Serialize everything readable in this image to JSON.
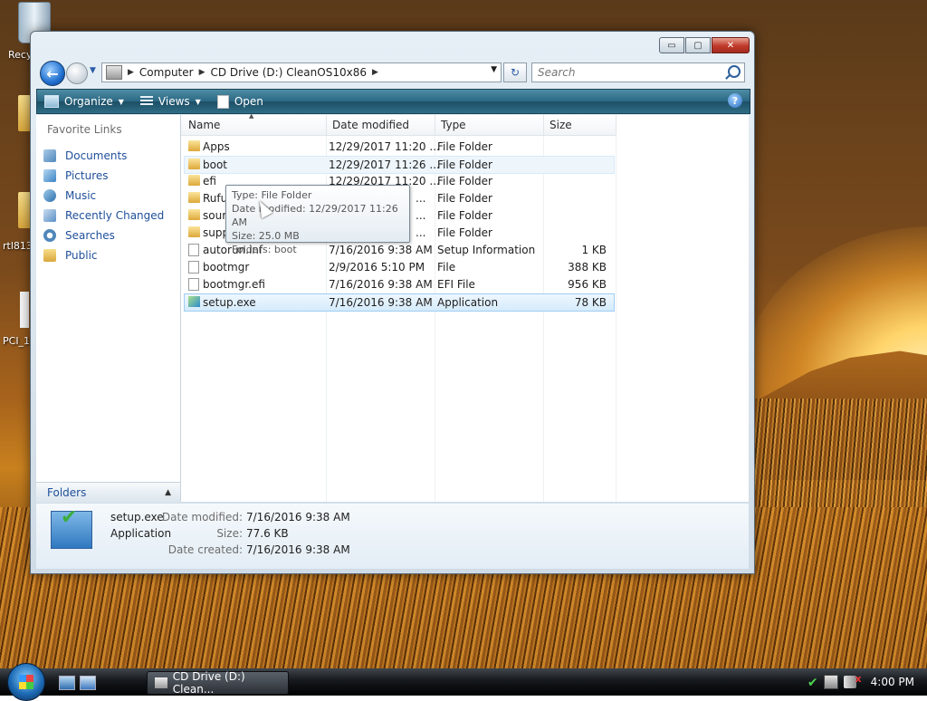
{
  "desktop": {
    "icons": [
      {
        "label": "Recy"
      },
      {
        "label": "rtl813"
      },
      {
        "label": "PCI_1("
      }
    ]
  },
  "window": {
    "buttons": {
      "minimize": "▭",
      "maximize": "▢",
      "close": "✕"
    },
    "address": {
      "crumbs": [
        "Computer",
        "CD Drive (D:) CleanOS10x86"
      ]
    },
    "search": {
      "placeholder": "Search"
    },
    "toolbar": {
      "organize": "Organize",
      "views": "Views",
      "open": "Open",
      "help": "?"
    },
    "nav": {
      "header": "Favorite Links",
      "items": [
        "Documents",
        "Pictures",
        "Music",
        "Recently Changed",
        "Searches",
        "Public"
      ],
      "folders_label": "Folders"
    },
    "columns": {
      "name": "Name",
      "date": "Date modified",
      "type": "Type",
      "size": "Size"
    },
    "files": [
      {
        "name": "Apps",
        "date": "12/29/2017 11:20 ...",
        "type": "File Folder",
        "size": "",
        "icon": "folder-icon"
      },
      {
        "name": "boot",
        "date": "12/29/2017 11:26 ...",
        "type": "File Folder",
        "size": "",
        "icon": "folder-icon"
      },
      {
        "name": "efi",
        "date": "12/29/2017 11:20 ...",
        "type": "File Folder",
        "size": "",
        "icon": "folder-icon"
      },
      {
        "name": "Rufu",
        "date": "...",
        "type": "File Folder",
        "size": "",
        "icon": "folder-icon"
      },
      {
        "name": "sour",
        "date": "...",
        "type": "File Folder",
        "size": "",
        "icon": "folder-icon"
      },
      {
        "name": "supp",
        "date": "...",
        "type": "File Folder",
        "size": "",
        "icon": "folder-icon"
      },
      {
        "name": "autorun.inf",
        "date": "7/16/2016 9:38 AM",
        "type": "Setup Information",
        "size": "1 KB",
        "icon": "inf-file-icon"
      },
      {
        "name": "bootmgr",
        "date": "2/9/2016 5:10 PM",
        "type": "File",
        "size": "388 KB",
        "icon": "file-icon"
      },
      {
        "name": "bootmgr.efi",
        "date": "7/16/2016 9:38 AM",
        "type": "EFI File",
        "size": "956 KB",
        "icon": "file-icon"
      },
      {
        "name": "setup.exe",
        "date": "7/16/2016 9:38 AM",
        "type": "Application",
        "size": "78 KB",
        "icon": "application-icon"
      }
    ],
    "tooltip": {
      "type": "Type: File Folder",
      "modified": "Date modified: 12/29/2017 11:26 AM",
      "size": "Size: 25.0 MB",
      "folders": "Folders: boot"
    },
    "details": {
      "name": "setup.exe",
      "type": "Application",
      "modified_label": "Date modified:",
      "modified": "7/16/2016 9:38 AM",
      "size_label": "Size:",
      "size": "77.6 KB",
      "created_label": "Date created:",
      "created": "7/16/2016 9:38 AM"
    }
  },
  "taskbar": {
    "task_label": "CD Drive (D:) Clean...",
    "clock": "4:00 PM"
  }
}
